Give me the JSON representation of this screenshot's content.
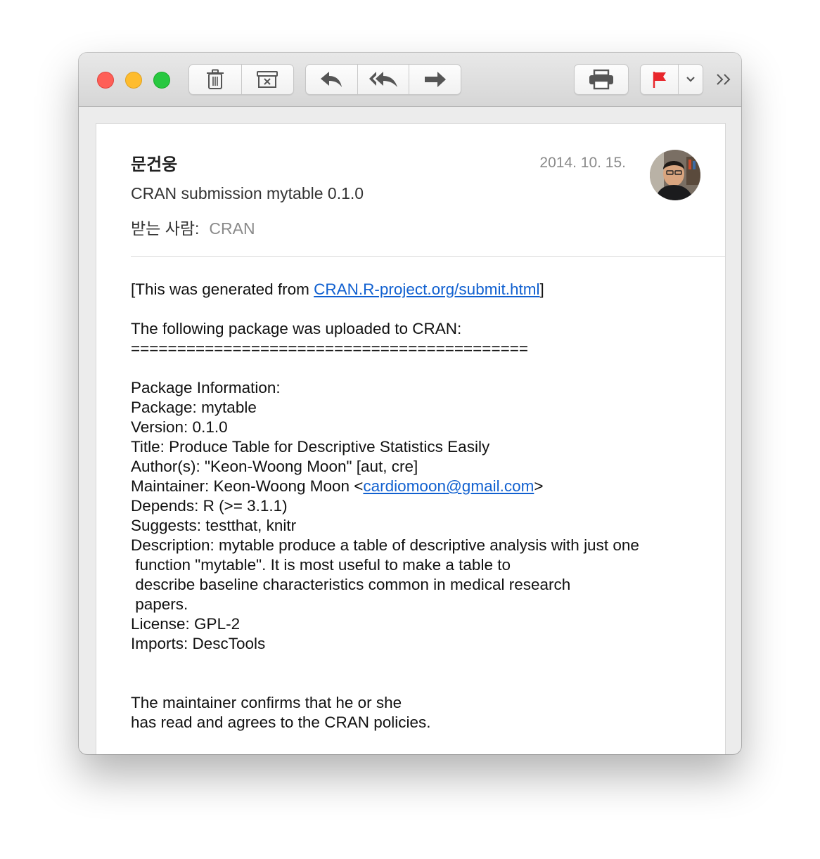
{
  "toolbar": {
    "buttons": [
      "trash-icon",
      "archive-icon",
      "reply-icon",
      "reply-all-icon",
      "forward-icon",
      "print-icon",
      "flag-icon",
      "chevron-down-icon",
      "more-icon"
    ],
    "flag_color": "#e8262b"
  },
  "header": {
    "sender": "문건웅",
    "date": "2014. 10. 15.",
    "subject": "CRAN submission mytable 0.1.0",
    "to_label": "받는 사람:",
    "to_value": "CRAN"
  },
  "body": {
    "line1_prefix": "[This was generated from ",
    "line1_link": "CRAN.R-project.org/submit.html",
    "line1_suffix": "]",
    "line2": "The following package was uploaded to CRAN:",
    "line3": "===========================================",
    "pkg_header": "Package Information:",
    "package": "Package: mytable",
    "version": "Version: 0.1.0",
    "title": "Title: Produce Table for Descriptive Statistics Easily",
    "authors": "Author(s): \"Keon-Woong Moon\" [aut, cre]",
    "maintainer_prefix": "Maintainer: Keon-Woong Moon <",
    "maintainer_email": "cardiomoon@gmail.com",
    "maintainer_suffix": ">",
    "depends": "Depends: R (>= 3.1.1)",
    "suggests": "Suggests: testthat, knitr",
    "desc1": "Description: mytable produce a table of descriptive analysis with just one",
    "desc2": " function \"mytable\". It is most useful to make a table to",
    "desc3": " describe baseline characteristics common in medical research",
    "desc4": " papers.",
    "license": "License: GPL-2",
    "imports": "Imports: DescTools",
    "confirm1": "The maintainer confirms that he or she",
    "confirm2": "has read and agrees to the CRAN policies."
  }
}
